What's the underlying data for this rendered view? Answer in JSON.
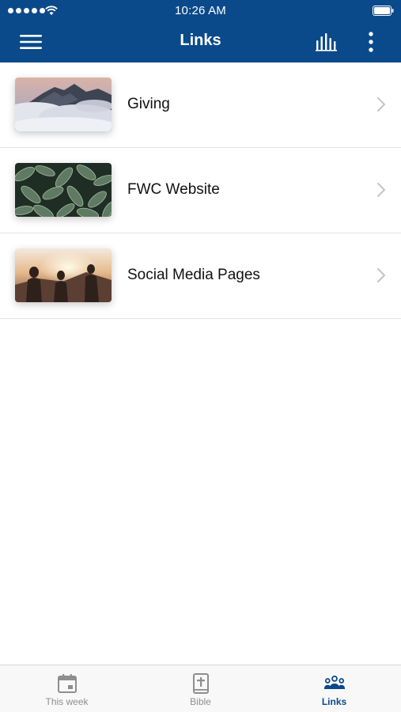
{
  "status_bar": {
    "time": "10:26 AM"
  },
  "header": {
    "title": "Links",
    "menu_icon": "hamburger-menu-icon",
    "chart_icon": "audio-bars-icon",
    "more_icon": "vertical-ellipsis-icon"
  },
  "links": [
    {
      "label": "Giving",
      "thumbnail": "mountain-clouds-photo"
    },
    {
      "label": "FWC Website",
      "thumbnail": "green-leaves-photo"
    },
    {
      "label": "Social Media Pages",
      "thumbnail": "friends-sunset-photo"
    }
  ],
  "tabs": [
    {
      "label": "This week",
      "icon": "calendar-icon",
      "active": false
    },
    {
      "label": "Bible",
      "icon": "bible-icon",
      "active": false
    },
    {
      "label": "Links",
      "icon": "group-icon",
      "active": true
    }
  ],
  "colors": {
    "brand": "#0a4a8a",
    "inactive_tab": "#8e8e8e",
    "divider": "#e2e2e2"
  }
}
